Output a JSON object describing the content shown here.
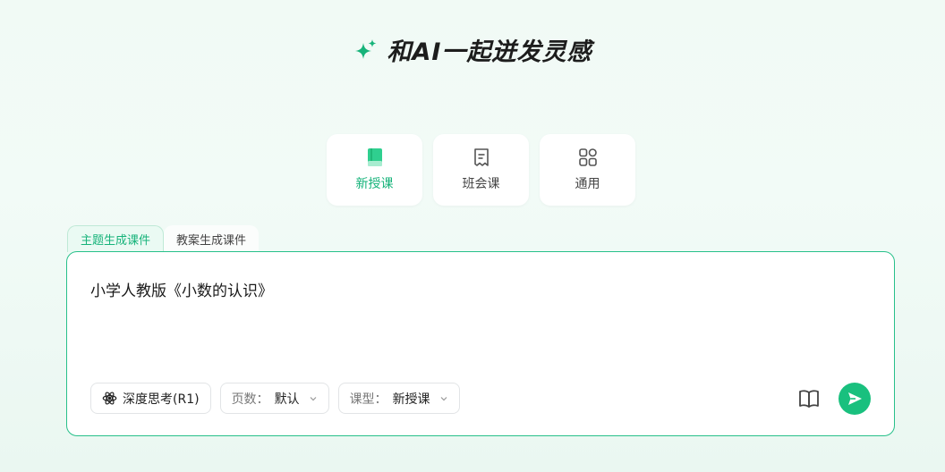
{
  "header": {
    "title": "和AI一起迸发灵感",
    "icon": "sparkle-icon",
    "accent_color": "#16b37a"
  },
  "course_types": [
    {
      "label": "新授课",
      "icon": "book-icon",
      "active": true
    },
    {
      "label": "班会课",
      "icon": "note-icon",
      "active": false
    },
    {
      "label": "通用",
      "icon": "grid-icon",
      "active": false
    }
  ],
  "tabs": [
    {
      "label": "主题生成课件",
      "active": true
    },
    {
      "label": "教案生成课件",
      "active": false
    }
  ],
  "input": {
    "value": "小学人教版《小数的认识》"
  },
  "controls": {
    "deep_think": {
      "label": "深度思考(R1)",
      "icon": "atom-icon"
    },
    "pages": {
      "label": "页数：",
      "value": "默认"
    },
    "course_type": {
      "label": "课型：",
      "value": "新授课"
    }
  },
  "tools": {
    "book_icon": "open-book-icon",
    "send_icon": "send-icon"
  }
}
